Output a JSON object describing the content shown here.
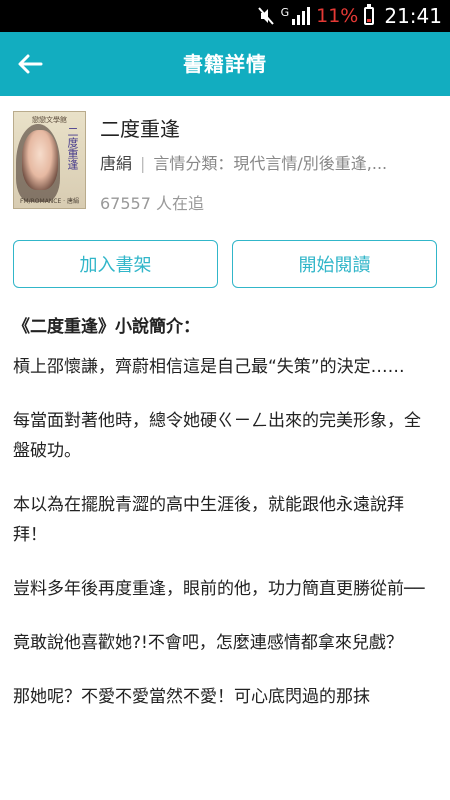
{
  "status_bar": {
    "network": "G",
    "battery_pct": "11%",
    "time": "21:41",
    "icons": [
      "mute-icon",
      "signal-icon",
      "battery-icon"
    ],
    "battery_color": "#e53935"
  },
  "app_bar": {
    "title": "書籍詳情",
    "back_icon": "back-arrow-icon",
    "color": "#12adc0"
  },
  "book": {
    "title": "二度重逢",
    "author": "唐絹",
    "category": "言情分類：現代言情/別後重逢,...",
    "followers": "67557 人在追",
    "cover": {
      "top_text": "戀戀文學館",
      "vertical_title": "二度重逢",
      "bottom_text": "FM/ROMANCE · 唐絹"
    }
  },
  "actions": {
    "add_to_shelf": "加入書架",
    "start_reading": "開始閱讀",
    "accent": "#31b6c9"
  },
  "intro": {
    "heading": "《二度重逢》小說簡介：",
    "paragraphs": [
      "槓上邵懷謙，齊蔚相信這是自己最“失策”的決定……",
      "每當面對著他時，總令她硬ㄍㄧㄥ出來的完美形象，全盤破功。",
      "本以為在擺脫青澀的高中生涯後，就能跟他永遠說拜拜！",
      "豈料多年後再度重逢，眼前的他，功力簡直更勝從前──",
      "竟敢說他喜歡她?!不會吧，怎麼連感情都拿來兒戲？",
      "那她呢？不愛不愛當然不愛！可心底閃過的那抹"
    ]
  }
}
